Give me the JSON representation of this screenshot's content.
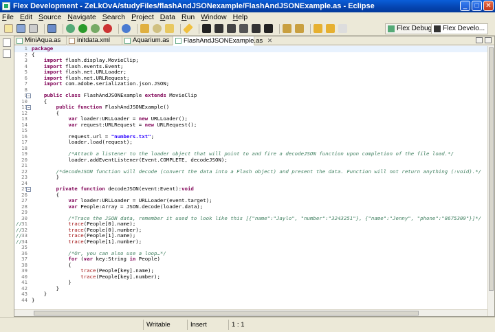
{
  "window": {
    "title": "Flex Development - ZeLkOvA/studyFiles/flashAndJSONexample/FlashAndJSONExample.as - Eclipse",
    "min": "_",
    "max": "□",
    "close": "✕"
  },
  "menu": [
    "File",
    "Edit",
    "Source",
    "Navigate",
    "Search",
    "Project",
    "Data",
    "Run",
    "Window",
    "Help"
  ],
  "perspectives": [
    "Flex Debug...",
    "Flex Develo..."
  ],
  "tabs": [
    {
      "label": "MiniAqua.as"
    },
    {
      "label": "initdata.xml"
    },
    {
      "label": "Aquarium.as"
    },
    {
      "label": "FlashAndJSONExample.as",
      "close": "✕"
    }
  ],
  "code_lines": [
    {
      "n": "1",
      "html": "<span class='kw'>package</span>"
    },
    {
      "n": "2",
      "html": "{"
    },
    {
      "n": "3",
      "html": "    <span class='kw'>import</span> flash.display.MovieClip;"
    },
    {
      "n": "4",
      "html": "    <span class='kw'>import</span> flash.events.Event;"
    },
    {
      "n": "5",
      "html": "    <span class='kw'>import</span> flash.net.URLLoader;"
    },
    {
      "n": "6",
      "html": "    <span class='kw'>import</span> flash.net.URLRequest;"
    },
    {
      "n": "7",
      "html": "    <span class='kw'>import</span> com.adobe.serialization.json.JSON;"
    },
    {
      "n": "8",
      "html": ""
    },
    {
      "n": "9",
      "fold": "−",
      "html": "    <span class='kw'>public class</span> FlashAndJSONExample <span class='kw'>extends</span> MovieClip"
    },
    {
      "n": "10",
      "html": "    {"
    },
    {
      "n": "11",
      "fold": "−",
      "html": "        <span class='kw'>public function</span> FlashAndJSONExample()"
    },
    {
      "n": "12",
      "html": "        {"
    },
    {
      "n": "13",
      "html": "            <span class='kw'>var</span> loader:URLLoader = <span class='kw'>new</span> URLLoader();"
    },
    {
      "n": "14",
      "html": "            <span class='kw'>var</span> request:URLRequest = <span class='kw'>new</span> URLRequest();"
    },
    {
      "n": "15",
      "html": ""
    },
    {
      "n": "16",
      "html": "            request.url = <span class='str'>\"numbers.txt\"</span>;"
    },
    {
      "n": "17",
      "html": "            loader.load(request);"
    },
    {
      "n": "18",
      "html": ""
    },
    {
      "n": "19",
      "html": "            <span class='com'>/*Attach a listener to the loader object that will point to and fire a decodeJSON function upon completion of the file load.*/</span>"
    },
    {
      "n": "20",
      "html": "            loader.addEventListener(Event.COMPLETE, decodeJSON);"
    },
    {
      "n": "21",
      "html": ""
    },
    {
      "n": "22",
      "html": "        <span class='com'>/*decodeJSON function will decode (convert the data into a Flash object) and present the data. Function will not return anything (:void).*/</span>"
    },
    {
      "n": "23",
      "html": "        }"
    },
    {
      "n": "24",
      "html": ""
    },
    {
      "n": "25",
      "fold": "−",
      "html": "        <span class='kw'>private function</span> decodeJSON(event:Event):<span class='kw'>void</span>"
    },
    {
      "n": "26",
      "html": "        {"
    },
    {
      "n": "27",
      "html": "            <span class='kw'>var</span> loader:URLLoader = URLLoader(event.target);"
    },
    {
      "n": "28",
      "html": "            <span class='kw'>var</span> People:Array = JSON.decode(loader.data);"
    },
    {
      "n": "29",
      "html": ""
    },
    {
      "n": "30",
      "html": "            <span class='com'>/*Trace the JSON data, remember it used to look like this [{\"name\":\"Jaylo\", \"number\":\"3243251\"}, {\"name\":\"Jenny\", \"phone\":\"8675309\"}]*/</span>"
    },
    {
      "n": "31",
      "cm": "//",
      "html": "            <span class='tr'>trace</span>(People[0].name);"
    },
    {
      "n": "32",
      "cm": "//",
      "html": "            <span class='tr'>trace</span>(People[0].number);"
    },
    {
      "n": "33",
      "cm": "//",
      "html": "            <span class='tr'>trace</span>(People[1].name);"
    },
    {
      "n": "34",
      "cm": "//",
      "html": "            <span class='tr'>trace</span>(People[1].number);"
    },
    {
      "n": "35",
      "html": ""
    },
    {
      "n": "36",
      "html": "            <span class='com'>/*Or, you can also use a loop…*/</span>"
    },
    {
      "n": "37",
      "html": "            <span class='kw'>for</span> (<span class='kw'>var</span> key:String <span class='kw'>in</span> People)"
    },
    {
      "n": "38",
      "html": "            {"
    },
    {
      "n": "39",
      "html": "                <span class='tr'>trace</span>(People[key].name);"
    },
    {
      "n": "40",
      "html": "                <span class='tr'>trace</span>(People[key].number);"
    },
    {
      "n": "41",
      "html": "            }"
    },
    {
      "n": "42",
      "html": "        }"
    },
    {
      "n": "43",
      "html": "    }"
    },
    {
      "n": "44",
      "html": "}"
    }
  ],
  "status": {
    "writable": "Writable",
    "insert": "Insert",
    "position": "1 : 1"
  },
  "colors": {
    "titlebar": "#0544b0",
    "keyword": "#7f0055",
    "string": "#2a00ff",
    "comment": "#3f7f5f",
    "chrome": "#ece9d8"
  }
}
